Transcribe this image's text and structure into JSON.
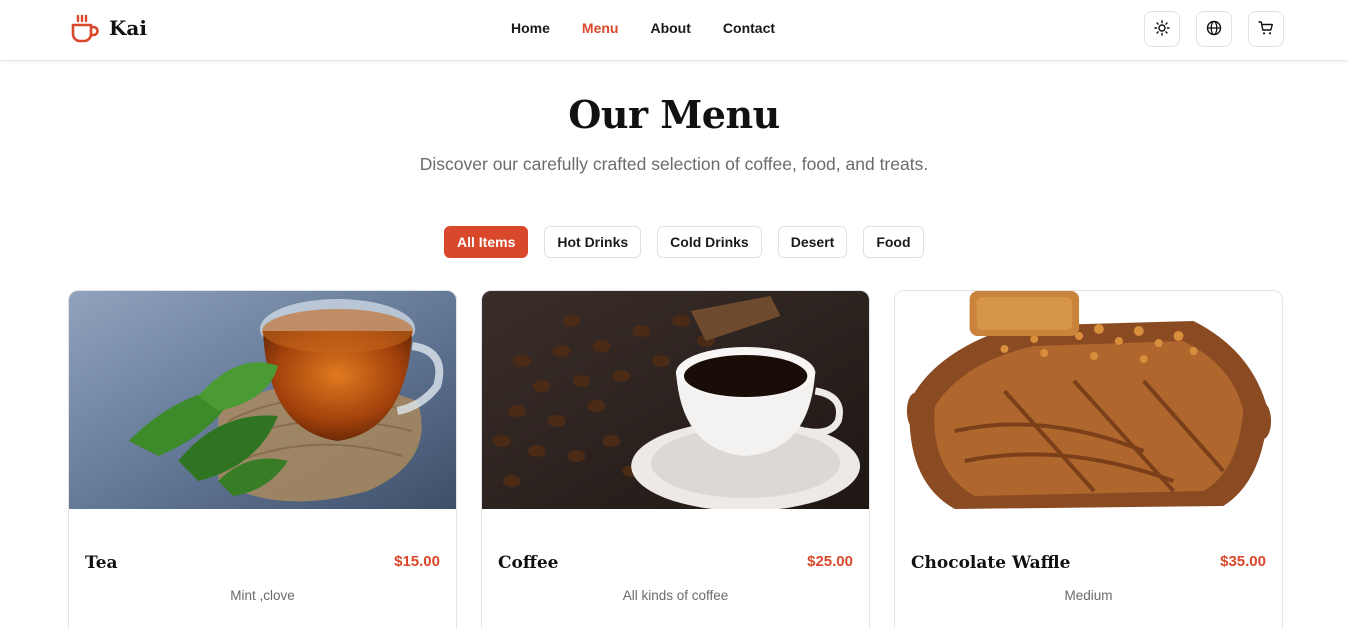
{
  "brand": {
    "name": "Kai",
    "accent_color": "#d9482b",
    "logo_icon": "coffee-cup-icon"
  },
  "nav": {
    "links": [
      {
        "label": "Home",
        "active": false
      },
      {
        "label": "Menu",
        "active": true
      },
      {
        "label": "About",
        "active": false
      },
      {
        "label": "Contact",
        "active": false
      }
    ],
    "icons": [
      "sun-icon",
      "globe-icon",
      "cart-icon"
    ]
  },
  "hero": {
    "title": "Our Menu",
    "subtitle": "Discover our carefully crafted selection of coffee, food, and treats."
  },
  "filters": [
    {
      "label": "All Items",
      "active": true
    },
    {
      "label": "Hot Drinks",
      "active": false
    },
    {
      "label": "Cold Drinks",
      "active": false
    },
    {
      "label": "Desert",
      "active": false
    },
    {
      "label": "Food",
      "active": false
    }
  ],
  "items": [
    {
      "name": "Tea",
      "price": "$15.00",
      "description": "Mint ,clove",
      "image": "tea-image"
    },
    {
      "name": "Coffee",
      "price": "$25.00",
      "description": "All kinds of coffee",
      "image": "coffee-image"
    },
    {
      "name": "Chocolate Waffle",
      "price": "$35.00",
      "description": "Medium",
      "image": "waffle-image"
    }
  ]
}
